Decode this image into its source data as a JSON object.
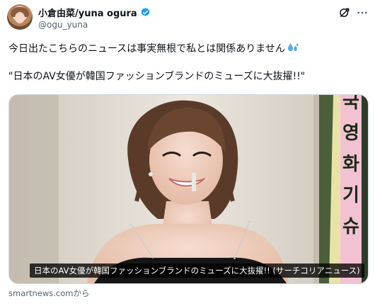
{
  "author": {
    "display_name": "小倉由菜/yuna ogura",
    "handle": "@ogu_yuna",
    "verified": true
  },
  "tweet": {
    "line1": "今日出たこちらのニュースは事実無根で私とは関係ありません",
    "line1_emoji": "droplets-emoji",
    "line2": "\"日本のAV女優が韓国ファッションブランドのミューズに大抜擢!!\""
  },
  "media": {
    "caption": "日本のAV女優が韓国ファッションブランドのミューズに大抜擢!! (サーチコリアニュース)",
    "banner_text": [
      "국",
      "영",
      "화",
      "기",
      "슈"
    ],
    "source": "smartnews.comから"
  },
  "icons": {
    "verified": "verified-badge-icon",
    "grok": "grok-icon",
    "more": "more-options-icon"
  },
  "colors": {
    "verified": "#1d9bf0",
    "handle": "#536471",
    "text": "#0f1419"
  }
}
